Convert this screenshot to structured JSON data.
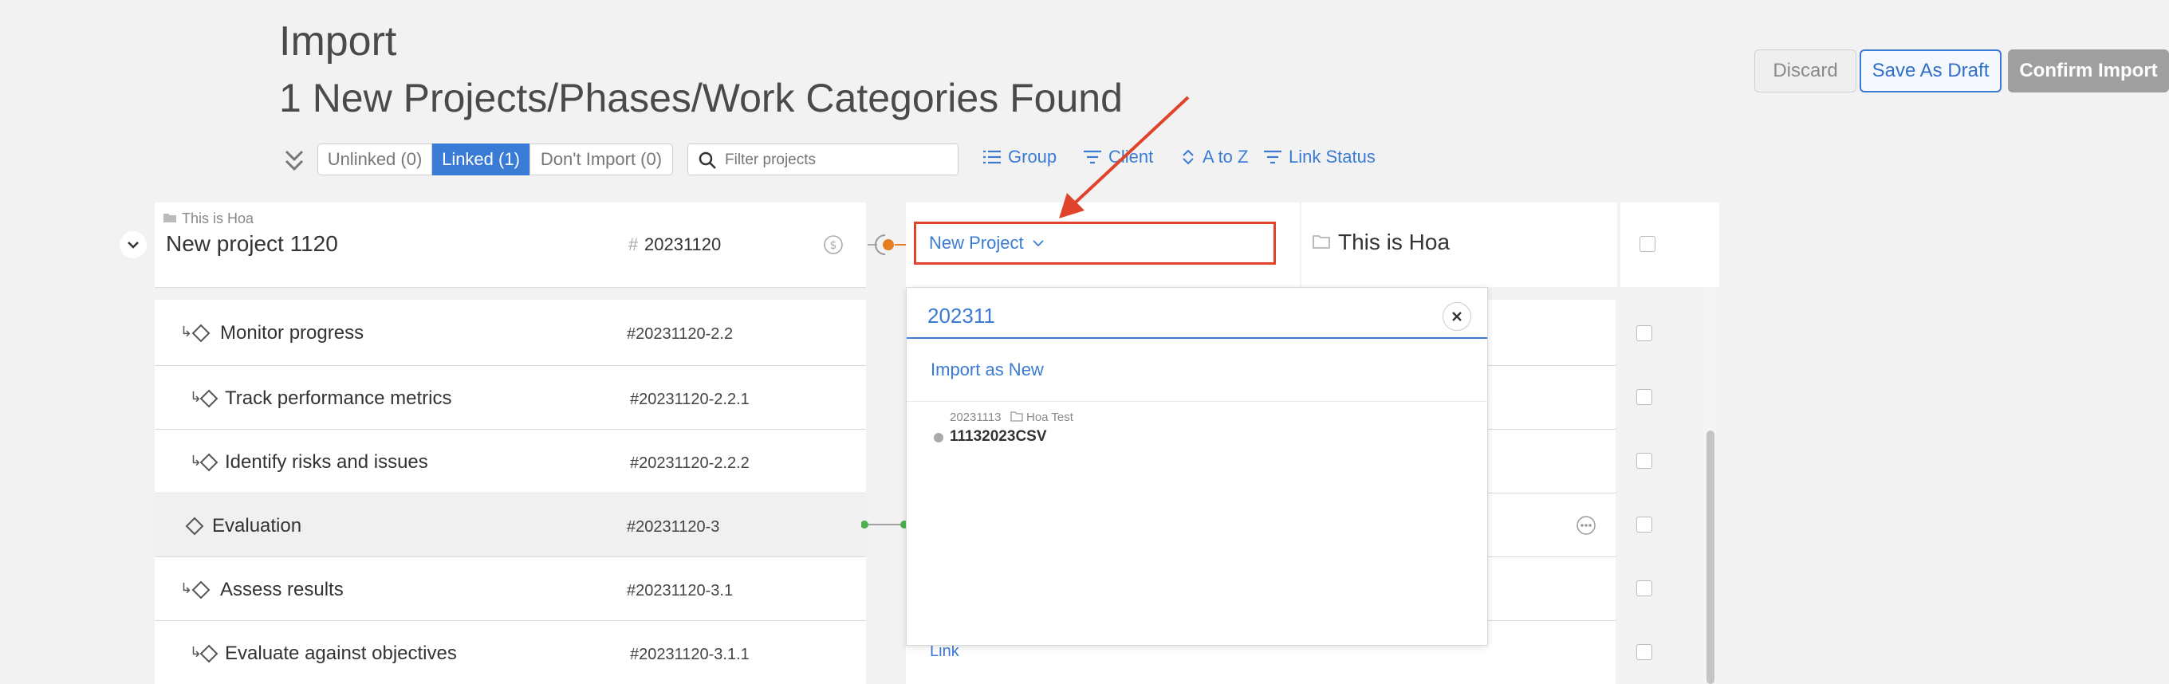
{
  "header": {
    "title": "Import",
    "subtitle": "1 New Projects/Phases/Work Categories Found",
    "discard": "Discard",
    "save_draft": "Save As Draft",
    "confirm": "Confirm Import"
  },
  "toolbar": {
    "tabs": [
      "Unlinked (0)",
      "Linked (1)",
      "Don't Import (0)"
    ],
    "filter_placeholder": "Filter projects",
    "group": "Group",
    "client": "Client",
    "sort": "A to Z",
    "link_status": "Link Status"
  },
  "project": {
    "client": "This is Hoa",
    "name": "New project 1120",
    "hash": "#",
    "number": "20231120",
    "link_select": "New Project",
    "target_name": "This is Hoa"
  },
  "rows": [
    {
      "name": "Monitor progress",
      "number": "#20231120-2.2"
    },
    {
      "name": "Track performance metrics",
      "number": "#20231120-2.2.1"
    },
    {
      "name": "Identify risks and issues",
      "number": "#20231120-2.2.2"
    },
    {
      "name": "Evaluation",
      "number": "#20231120-3"
    },
    {
      "name": "Assess results",
      "number": "#20231120-3.1"
    },
    {
      "name": "Evaluate against objectives",
      "number": "#20231120-3.1.1"
    }
  ],
  "dropdown": {
    "query": "202311",
    "import_as_new": "Import as New",
    "result_number": "20231113",
    "result_client": "Hoa Test",
    "result_name": "11132023CSV"
  },
  "link_label": "Link",
  "colors": {
    "accent": "#3a7bd5",
    "highlight_border": "#e0432b",
    "link_line": "#4caf50",
    "status_dot": "#e67e22"
  }
}
